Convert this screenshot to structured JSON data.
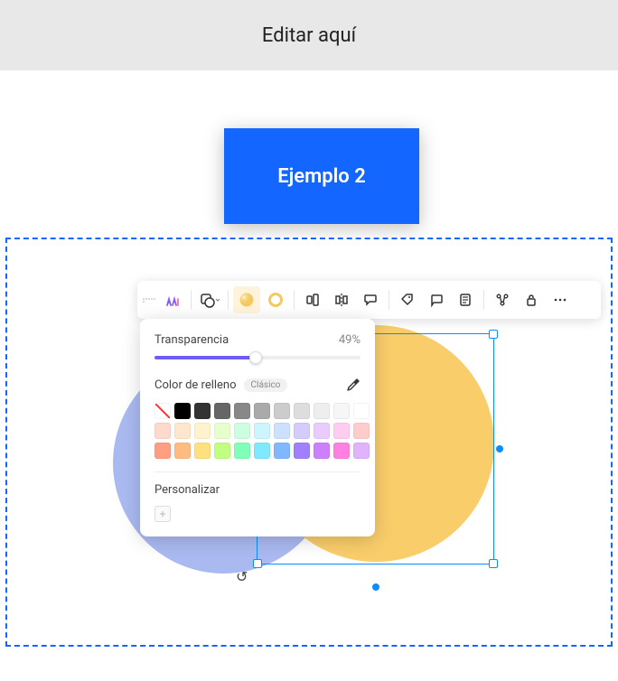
{
  "header": {
    "title": "Editar aquí"
  },
  "example_box": {
    "label": "Ejemplo 2"
  },
  "toolbar": {
    "items": [
      {
        "name": "ai-icon",
        "active": false
      },
      {
        "name": "shape-dropdown-icon",
        "active": false
      },
      {
        "name": "fill-color-icon",
        "active": true
      },
      {
        "name": "stroke-color-icon",
        "active": false
      },
      {
        "name": "align-horizontal-icon",
        "active": false
      },
      {
        "name": "flip-horizontal-icon",
        "active": false
      },
      {
        "name": "speech-bubble-icon",
        "active": false
      },
      {
        "name": "tag-icon",
        "active": false
      },
      {
        "name": "comment-icon",
        "active": false
      },
      {
        "name": "note-icon",
        "active": false
      },
      {
        "name": "link-icon",
        "active": false
      },
      {
        "name": "lock-icon",
        "active": false
      },
      {
        "name": "more-icon",
        "active": false
      }
    ]
  },
  "panel": {
    "transparency_label": "Transparencia",
    "transparency_value": "49%",
    "transparency_percent": 49,
    "fill_label": "Color de relleno",
    "pill_label": "Clásico",
    "customize_label": "Personalizar",
    "swatches_row1": [
      "nofill",
      "#000000",
      "#333333",
      "#666666",
      "#888888",
      "#aaaaaa",
      "#cccccc",
      "#dddddd",
      "#eeeeee",
      "#f6f6f6",
      "#ffffff"
    ],
    "swatches_row2": [
      "#ffd9cc",
      "#ffe6cc",
      "#fff2cc",
      "#e6ffcc",
      "#ccffe0",
      "#ccf5ff",
      "#cce0ff",
      "#d4ccff",
      "#e8ccff",
      "#ffccf2",
      "#ffcccc"
    ],
    "swatches_row3": [
      "#ff9e80",
      "#ffbb80",
      "#ffe080",
      "#c0ff80",
      "#80ffb8",
      "#80e8ff",
      "#80b8ff",
      "#a080ff",
      "#cc80ff",
      "#ff80e0",
      "#e0b3ff"
    ]
  }
}
